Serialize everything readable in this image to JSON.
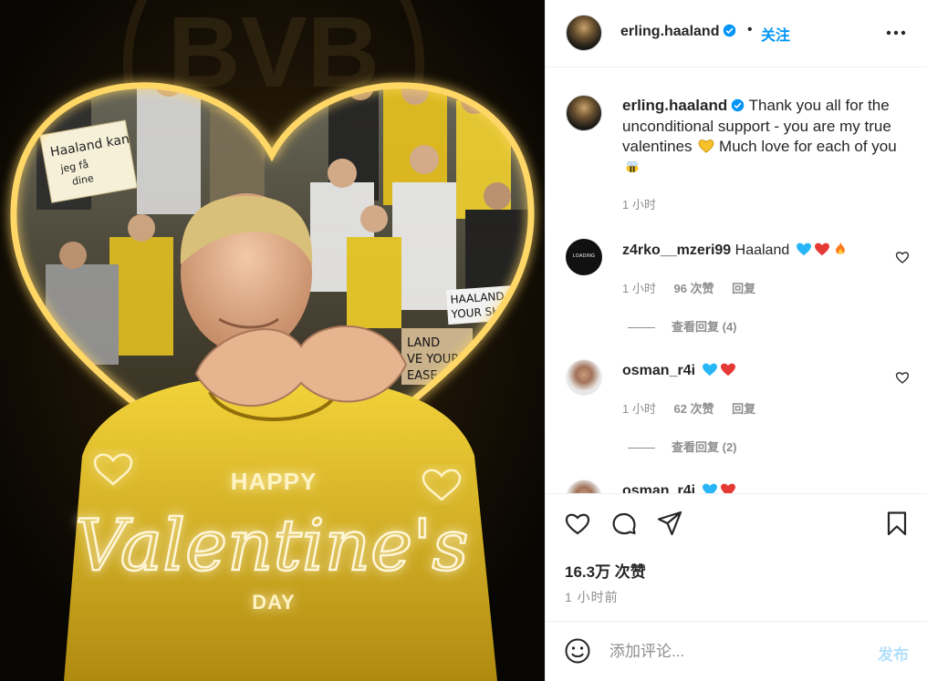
{
  "post": {
    "author": "erling.haaland",
    "follow_label": "关注",
    "separator": "•",
    "image": {
      "alt_lettering": [
        "HAPPY",
        "Valentine's",
        "DAY"
      ],
      "sign_texts": [
        "Haaland kan jeg få dine",
        "BVB",
        "HAALAND CAN I HAVE YOUR SHIRT?",
        "LAND VE YOUR EASE"
      ]
    }
  },
  "caption": {
    "username": "erling.haaland",
    "text": "Thank you all for the unconditional support - you are my true valentines",
    "text_after_emoji": "Much love for each of you",
    "time": "1 小时"
  },
  "comments": [
    {
      "username": "z4rko__mzeri99",
      "text": "Haaland",
      "avatar_text": "LOADING",
      "time": "1 小时",
      "likes": "96 次赞",
      "reply_label": "回复",
      "view_replies": "查看回复 (4)",
      "emojis": [
        "blue-heart",
        "red-heart",
        "fire"
      ]
    },
    {
      "username": "osman_r4i",
      "text": "",
      "time": "1 小时",
      "likes": "62 次赞",
      "reply_label": "回复",
      "view_replies": "查看回复 (2)",
      "emojis": [
        "blue-heart",
        "red-heart"
      ]
    },
    {
      "username": "osman_r4i",
      "text": "",
      "emojis": [
        "blue-heart",
        "red-heart"
      ]
    }
  ],
  "actions": {
    "likes_count": "16.3万 次赞",
    "posted_ago": "1 小时前"
  },
  "composer": {
    "placeholder": "添加评论...",
    "post_label": "发布"
  },
  "colors": {
    "accent": "#0095f6",
    "post_disabled": "#b2dffc",
    "glow_gold": "#ffd766",
    "jersey_yellow": "#f5d63a",
    "secondary_text": "#8e8e8e"
  }
}
